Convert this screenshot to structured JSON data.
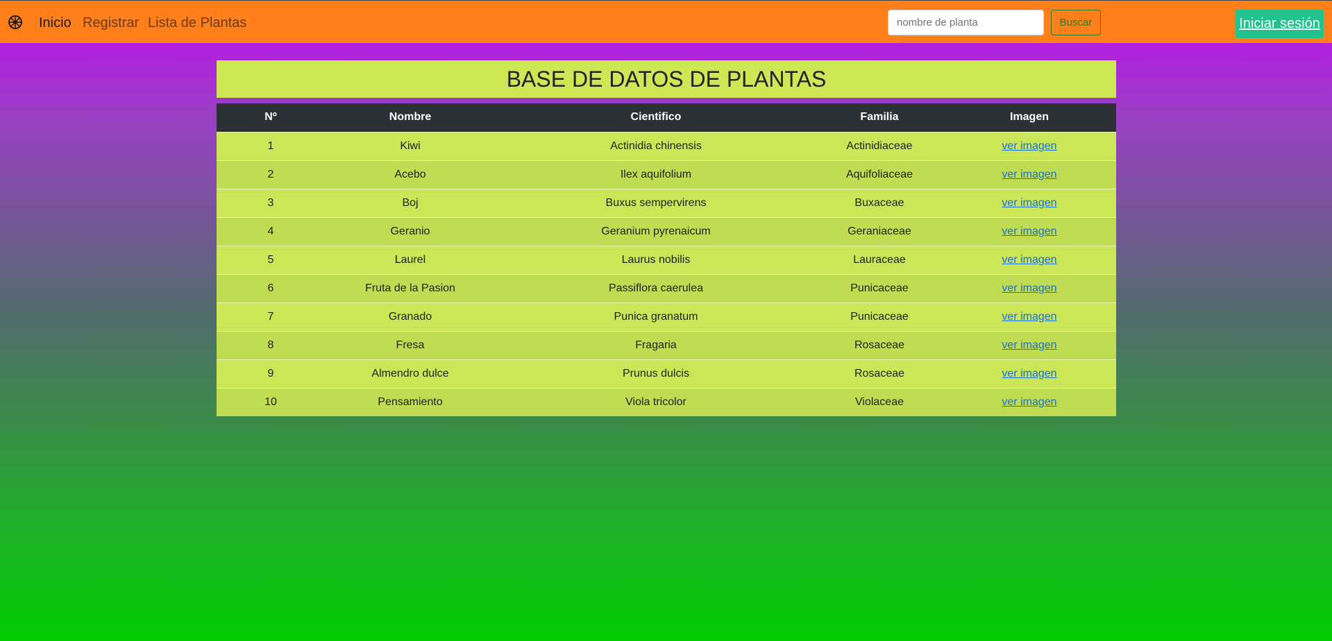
{
  "navbar": {
    "brand_icon": "wheel-icon",
    "links": [
      "Inicio",
      "Registrar",
      "Lista de Plantas"
    ],
    "search": {
      "placeholder": "nombre de planta",
      "button": "Buscar"
    },
    "login": "Iniciar sesión",
    "colors": {
      "bar": "#ff7f1a",
      "login_bg": "#22c38e"
    }
  },
  "main": {
    "title": "BASE DE DATOS DE PLANTAS",
    "table": {
      "headers": [
        "Nº",
        "Nombre",
        "Cientifico",
        "Familia",
        "Imagen"
      ],
      "rows": [
        [
          "1",
          "Kiwi",
          "Actinidia chinensis",
          "Actinidiaceae",
          "ver imagen"
        ],
        [
          "2",
          "Acebo",
          "Ilex aquifolium",
          "Aquifoliaceae",
          "ver imagen"
        ],
        [
          "3",
          "Boj",
          "Buxus sempervirens",
          "Buxaceae",
          "ver imagen"
        ],
        [
          "4",
          "Geranio",
          "Geranium pyrenaicum",
          "Geraniaceae",
          "ver imagen"
        ],
        [
          "5",
          "Laurel",
          "Laurus nobilis",
          "Lauraceae",
          "ver imagen"
        ],
        [
          "6",
          "Fruta de la Pasion",
          "Passiflora caerulea",
          "Punicaceae",
          "ver imagen"
        ],
        [
          "7",
          "Granado",
          "Punica granatum",
          "Punicaceae",
          "ver imagen"
        ],
        [
          "8",
          "Fresa",
          "Fragaria",
          "Rosaceae",
          "ver imagen"
        ],
        [
          "9",
          "Almendro dulce",
          "Prunus dulcis",
          "Rosaceae",
          "ver imagen"
        ],
        [
          "10",
          "Pensamiento",
          "Viola tricolor",
          "Violaceae",
          "ver imagen"
        ]
      ]
    }
  }
}
